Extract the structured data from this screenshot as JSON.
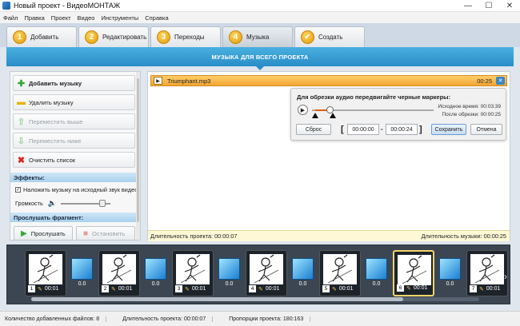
{
  "window": {
    "title": "Новый проект - ВидеоМОНТАЖ",
    "minimize": "—",
    "maximize": "☐",
    "close": "✕"
  },
  "menu": [
    "Файл",
    "Правка",
    "Проект",
    "Видео",
    "Инструменты",
    "Справка"
  ],
  "tabs": [
    {
      "num": "1",
      "label": "Добавить"
    },
    {
      "num": "2",
      "label": "Редактировать"
    },
    {
      "num": "3",
      "label": "Переходы"
    },
    {
      "num": "4",
      "label": "Музыка",
      "active": true
    },
    {
      "num": "✔",
      "label": "Создать"
    }
  ],
  "banner": "МУЗЫКА ДЛЯ ВСЕГО ПРОЕКТА",
  "left": {
    "buttons": [
      {
        "label": "Добавить музыку",
        "icon": "plus-icon",
        "enabled": true
      },
      {
        "label": "Удалить музыку",
        "icon": "minus-icon",
        "enabled": true
      },
      {
        "label": "Переместить выше",
        "icon": "arrow-up-icon",
        "enabled": false
      },
      {
        "label": "Переместить ниже",
        "icon": "arrow-down-icon",
        "enabled": false
      },
      {
        "label": "Очистить список",
        "icon": "clear-icon",
        "enabled": true
      }
    ],
    "effects_title": "Эффекты:",
    "overlay_checkbox": "Наложить музыку на исходный звук видео",
    "overlay_checked": true,
    "volume_label": "Громкость",
    "volume_level": 0.8,
    "preview_title": "Прослушать фрагмент:",
    "listen_button": "Прослушать",
    "stop_button": "Остановить"
  },
  "track": {
    "name": "Triumphant.mp3",
    "duration": "00:25"
  },
  "trim": {
    "hint": "Для обрезки аудио передвигайте черные маркеры:",
    "original_time": "Исходное время: 00:03:39",
    "after_trim": "После обрезки: 00:00:25",
    "reset": "Сброс",
    "start": "00:00:00",
    "sep": "-",
    "end": "00:00:24",
    "save": "Сохранить",
    "cancel": "Отмена"
  },
  "project_duration": "Длительность проекта: 00:00:07",
  "music_duration": "Длительность музыки: 00:00:25",
  "timeline": {
    "frames": [
      {
        "n": "1",
        "d": "00:01"
      },
      {
        "n": "2",
        "d": "00:01"
      },
      {
        "n": "3",
        "d": "00:01"
      },
      {
        "n": "4",
        "d": "00:01"
      },
      {
        "n": "5",
        "d": "00:01"
      },
      {
        "n": "6",
        "d": "00:01"
      },
      {
        "n": "7",
        "d": "00:01"
      }
    ],
    "transitions": [
      "0.0",
      "0.0",
      "0.0",
      "0.0",
      "0.0",
      "0.0"
    ],
    "selected_frame": "6"
  },
  "status": {
    "files": "Количество добавленных файлов: 8",
    "duration": "Длительность проекта: 00:00:07",
    "ratio": "Пропорции проекта: 180:163"
  }
}
